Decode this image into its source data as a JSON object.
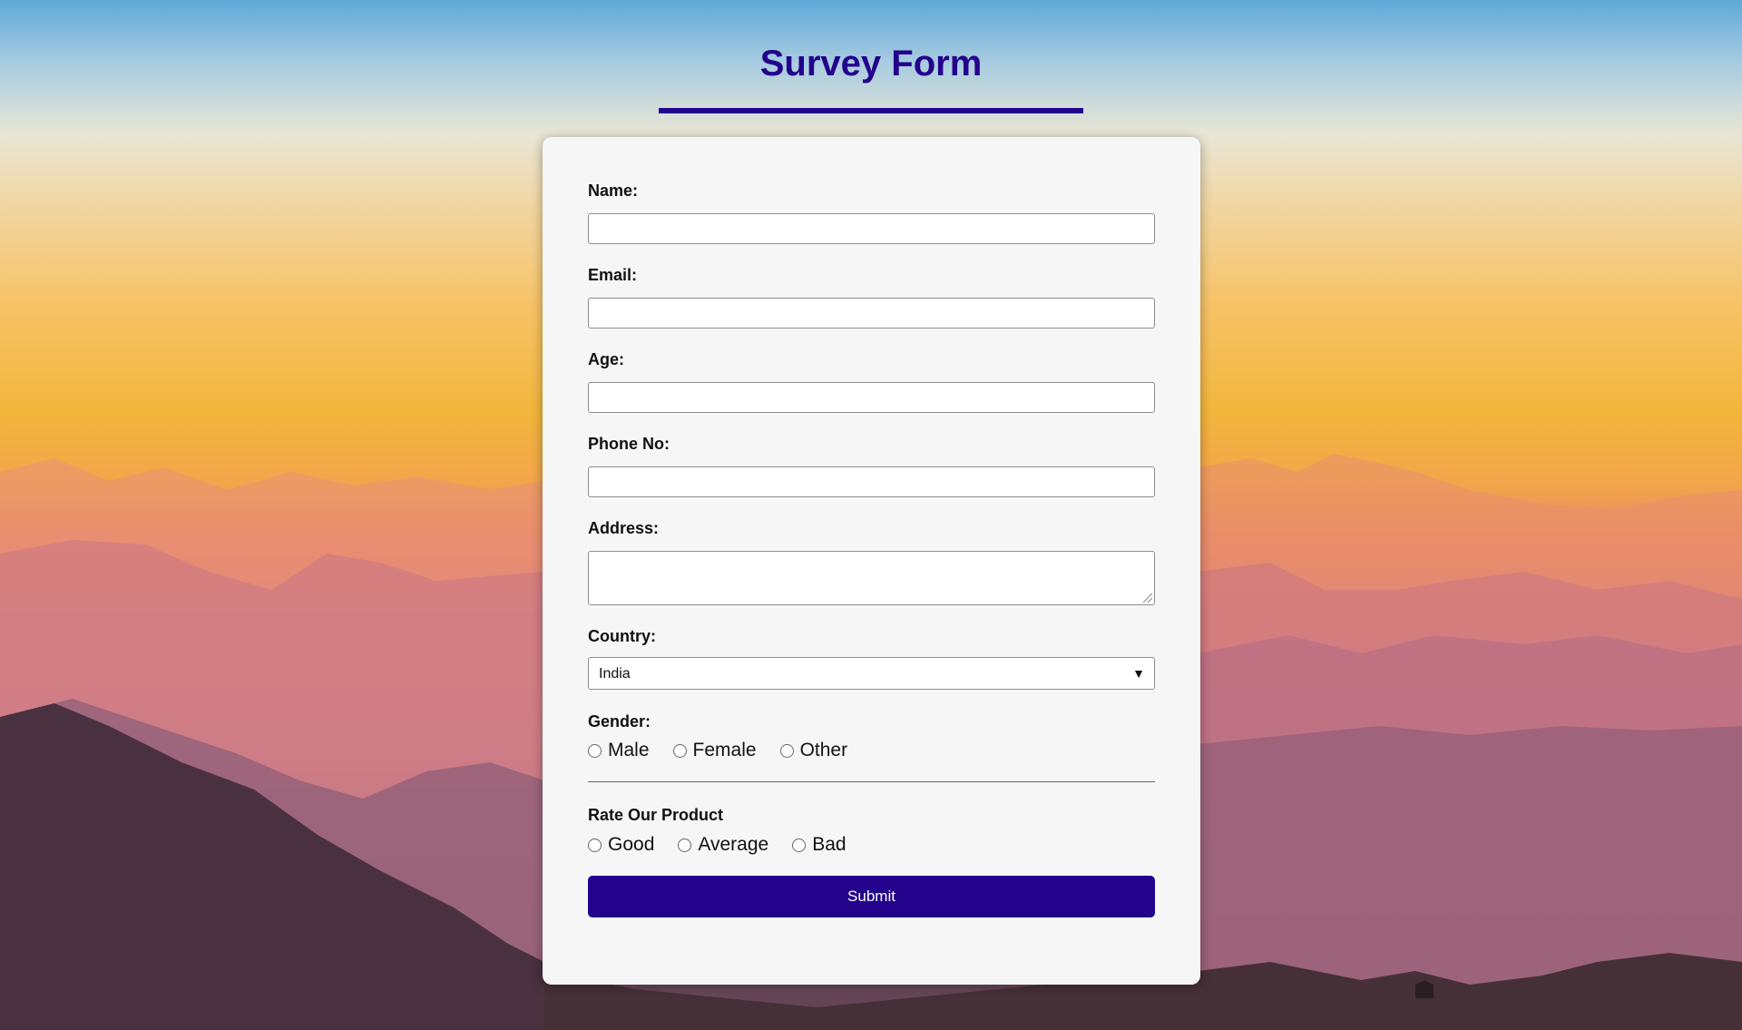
{
  "page": {
    "title": "Survey Form",
    "accent_color": "#23038c",
    "card_color": "#f6f6f6"
  },
  "form": {
    "name_label": "Name:",
    "email_label": "Email:",
    "age_label": "Age:",
    "phone_label": "Phone No:",
    "address_label": "Address:",
    "country_label": "Country:",
    "country_value": "India",
    "gender_label": "Gender:",
    "gender_options": [
      "Male",
      "Female",
      "Other"
    ],
    "rating_label": "Rate Our Product",
    "rating_options": [
      "Good",
      "Average",
      "Bad"
    ],
    "submit_label": "Submit"
  },
  "icons": {
    "select_chevron": "chevron-down-icon",
    "textarea_resize": "resize-grip-icon"
  }
}
